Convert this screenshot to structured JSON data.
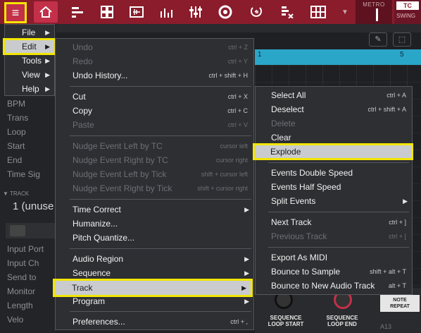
{
  "topbar": {
    "menu_icon": "hamburger-icon",
    "home_icon": "home-icon",
    "toolbar_icons": [
      "arrange-icon",
      "grid-pads-icon",
      "sample-edit-icon",
      "mixer-icon",
      "channel-mixer-icon",
      "record-icon",
      "loop-icon",
      "sample-delete-icon",
      "step-grid-icon",
      "dropdown-icon"
    ],
    "metro_label": "METRO",
    "tc_label": "TC",
    "swing_label": "SWING",
    "accent_color": "#8a1c2c"
  },
  "background": {
    "left_rows": [
      "BPM",
      "Trans",
      "Loop",
      "Start",
      "End",
      "Time Sig"
    ],
    "track_header": "TRACK",
    "track_name": "1 (unuse",
    "track_rows": [
      "Input Port",
      "Input Ch",
      "Send to",
      "Monitor",
      "Length",
      "Velo"
    ],
    "ruler_numbers": [
      "1",
      "5"
    ],
    "knob1_label": "SEQUENCE\nLOOP START",
    "knob2_label": "SEQUENCE\nLOOP END",
    "note_repeat": "NOTE\nREPEAT",
    "pad_label": "A13"
  },
  "main_menu": {
    "items": [
      {
        "label": "File",
        "arrow": "▶"
      },
      {
        "label": "Edit",
        "arrow": "▶"
      },
      {
        "label": "Tools",
        "arrow": "▶"
      },
      {
        "label": "View",
        "arrow": "▶"
      },
      {
        "label": "Help",
        "arrow": "▶"
      }
    ]
  },
  "edit_menu": {
    "items": [
      {
        "label": "Undo",
        "shortcut": "ctrl + Z",
        "enabled": false
      },
      {
        "label": "Redo",
        "shortcut": "ctrl + Y",
        "enabled": false
      },
      {
        "label": "Undo History...",
        "shortcut": "ctrl + shift + H",
        "enabled": true
      },
      {
        "label": "Cut",
        "shortcut": "ctrl + X",
        "enabled": true
      },
      {
        "label": "Copy",
        "shortcut": "ctrl + C",
        "enabled": true
      },
      {
        "label": "Paste",
        "shortcut": "ctrl + V",
        "enabled": false
      },
      {
        "label": "Nudge Event Left by TC",
        "shortcut": "cursor left",
        "enabled": false
      },
      {
        "label": "Nudge Event Right by TC",
        "shortcut": "cursor right",
        "enabled": false
      },
      {
        "label": "Nudge Event Left by Tick",
        "shortcut": "shift + cursor left",
        "enabled": false
      },
      {
        "label": "Nudge Event Right by Tick",
        "shortcut": "shift + cursor right",
        "enabled": false
      },
      {
        "label": "Time Correct",
        "arrow": "▶",
        "enabled": true
      },
      {
        "label": "Humanize...",
        "enabled": true
      },
      {
        "label": "Pitch Quantize...",
        "enabled": true
      },
      {
        "label": "Audio Region",
        "arrow": "▶",
        "enabled": true
      },
      {
        "label": "Sequence",
        "arrow": "▶",
        "enabled": true
      },
      {
        "label": "Track",
        "arrow": "▶",
        "enabled": true
      },
      {
        "label": "Program",
        "arrow": "▶",
        "enabled": true
      },
      {
        "label": "Preferences...",
        "shortcut": "ctrl + ,",
        "enabled": true
      }
    ]
  },
  "track_menu": {
    "items": [
      {
        "label": "Select All",
        "shortcut": "ctrl + A",
        "enabled": true
      },
      {
        "label": "Deselect",
        "shortcut": "ctrl + shift + A",
        "enabled": true
      },
      {
        "label": "Delete",
        "enabled": false
      },
      {
        "label": "Clear",
        "enabled": true
      },
      {
        "label": "Explode",
        "enabled": true
      },
      {
        "label": "Events Double Speed",
        "enabled": true
      },
      {
        "label": "Events Half Speed",
        "enabled": true
      },
      {
        "label": "Split Events",
        "arrow": "▶",
        "enabled": true
      },
      {
        "label": "Next Track",
        "shortcut": "ctrl + ]",
        "enabled": true
      },
      {
        "label": "Previous Track",
        "shortcut": "ctrl + [",
        "enabled": false
      },
      {
        "label": "Export As MIDI",
        "enabled": true
      },
      {
        "label": "Bounce to Sample",
        "shortcut": "shift + alt + T",
        "enabled": true
      },
      {
        "label": "Bounce to New Audio Track",
        "shortcut": "alt + T",
        "enabled": true
      }
    ]
  },
  "highlight_color": "#f2e600"
}
